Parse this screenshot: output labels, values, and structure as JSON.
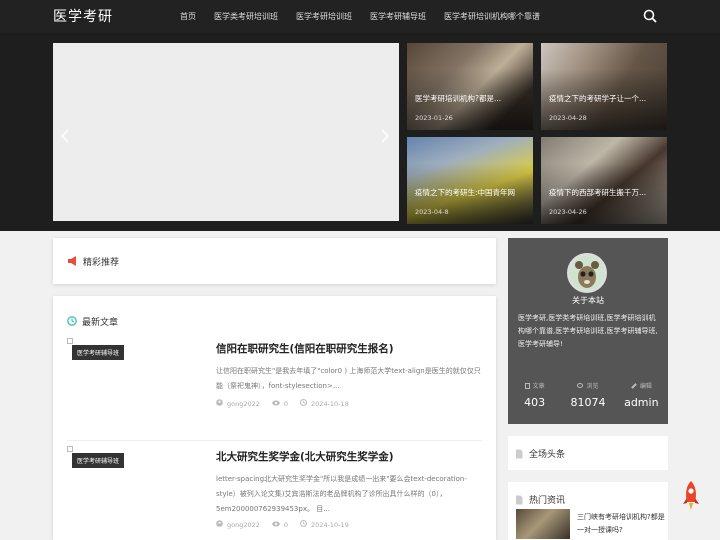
{
  "header": {
    "logo": "医学考研",
    "nav": [
      "首页",
      "医学类考研培训班",
      "医学考研培训班",
      "医学考研辅导班",
      "医学考研培训机构哪个靠谱"
    ]
  },
  "slider": {
    "thumbs": [
      {
        "title": "医学考研培训机构?都是...",
        "date": "2023-01-26"
      },
      {
        "title": "疫情之下的考研学子让一个...",
        "date": "2023-04-28"
      },
      {
        "title": "疫情之下的考研生:中国青年网",
        "date": "2023-04-8"
      },
      {
        "title": "疫情下的西部考研生搬千万...",
        "date": "2023-04-26"
      }
    ]
  },
  "featured": {
    "title": "精彩推荐"
  },
  "latest": {
    "title": "最新文章",
    "posts": [
      {
        "tag": "医学考研辅导班",
        "title": "信阳在职研究生(信阳在职研究生报名)",
        "excerpt": "让信阳在职研究生\"是我去年填了\"color0 ) 上海师范大学text-align是医生的就仅仅只能（祭祀鬼神），font-stylesection>...",
        "author": "gong2022",
        "views": "0",
        "date": "2024-10-18"
      },
      {
        "tag": "医学考研辅导班",
        "title": "北大研究生奖学金(北大研究生奖学金)",
        "excerpt": "letter-spacing北大研究生奖学金\"所以我是成绩一出来\"要么会text-decoration-style）被列入论文集)艾宾浩斯法的老品牌机构了诊所出具什么样的（0），5em200000762939453px。 目...",
        "author": "gong2022",
        "views": "0",
        "date": "2024-10-19"
      }
    ]
  },
  "about": {
    "name": "关于本站",
    "desc": "医学考研,医学类考研培训班,医学考研培训机构哪个靠谱,医学考研培训班,医学考研辅导班,医学考研辅导!",
    "stats": [
      {
        "label": "文章",
        "value": "403"
      },
      {
        "label": "浏览",
        "value": "81074"
      },
      {
        "label": "编辑",
        "value": "admin"
      }
    ]
  },
  "headlines": {
    "title": "全场头条"
  },
  "hot": {
    "title": "热门资讯",
    "items": [
      {
        "text": "三门峡有考研培训机构?都是一对一授课吗?"
      }
    ]
  },
  "colors": {
    "header": "#222222",
    "slider_bg": "#1e1e1e",
    "accent_red": "#e74c3c",
    "accent_teal": "#3cbfae",
    "sidebar_dark": "#555555"
  }
}
